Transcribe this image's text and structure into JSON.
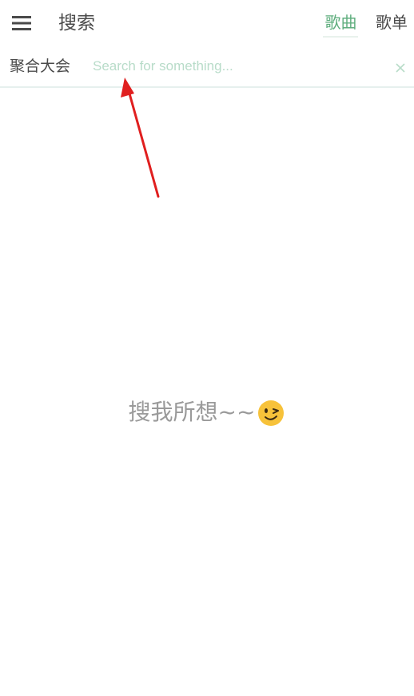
{
  "header": {
    "title": "搜索",
    "menu_icon": "hamburger-menu-icon",
    "tabs": [
      {
        "label": "歌曲",
        "active": true
      },
      {
        "label": "歌单",
        "active": false
      }
    ]
  },
  "search": {
    "source_label": "聚合大会",
    "placeholder": "Search for something...",
    "value": "",
    "clear_icon": "close-icon"
  },
  "empty_state": {
    "text": "搜我所想~~",
    "emoji_icon": "wink-emoji-icon"
  },
  "colors": {
    "accent": "#5fae7e",
    "placeholder": "#b8dcc9",
    "text": "#4a4a4a",
    "muted_text": "#9a9a9a",
    "annotation_arrow": "#e01f1f"
  }
}
